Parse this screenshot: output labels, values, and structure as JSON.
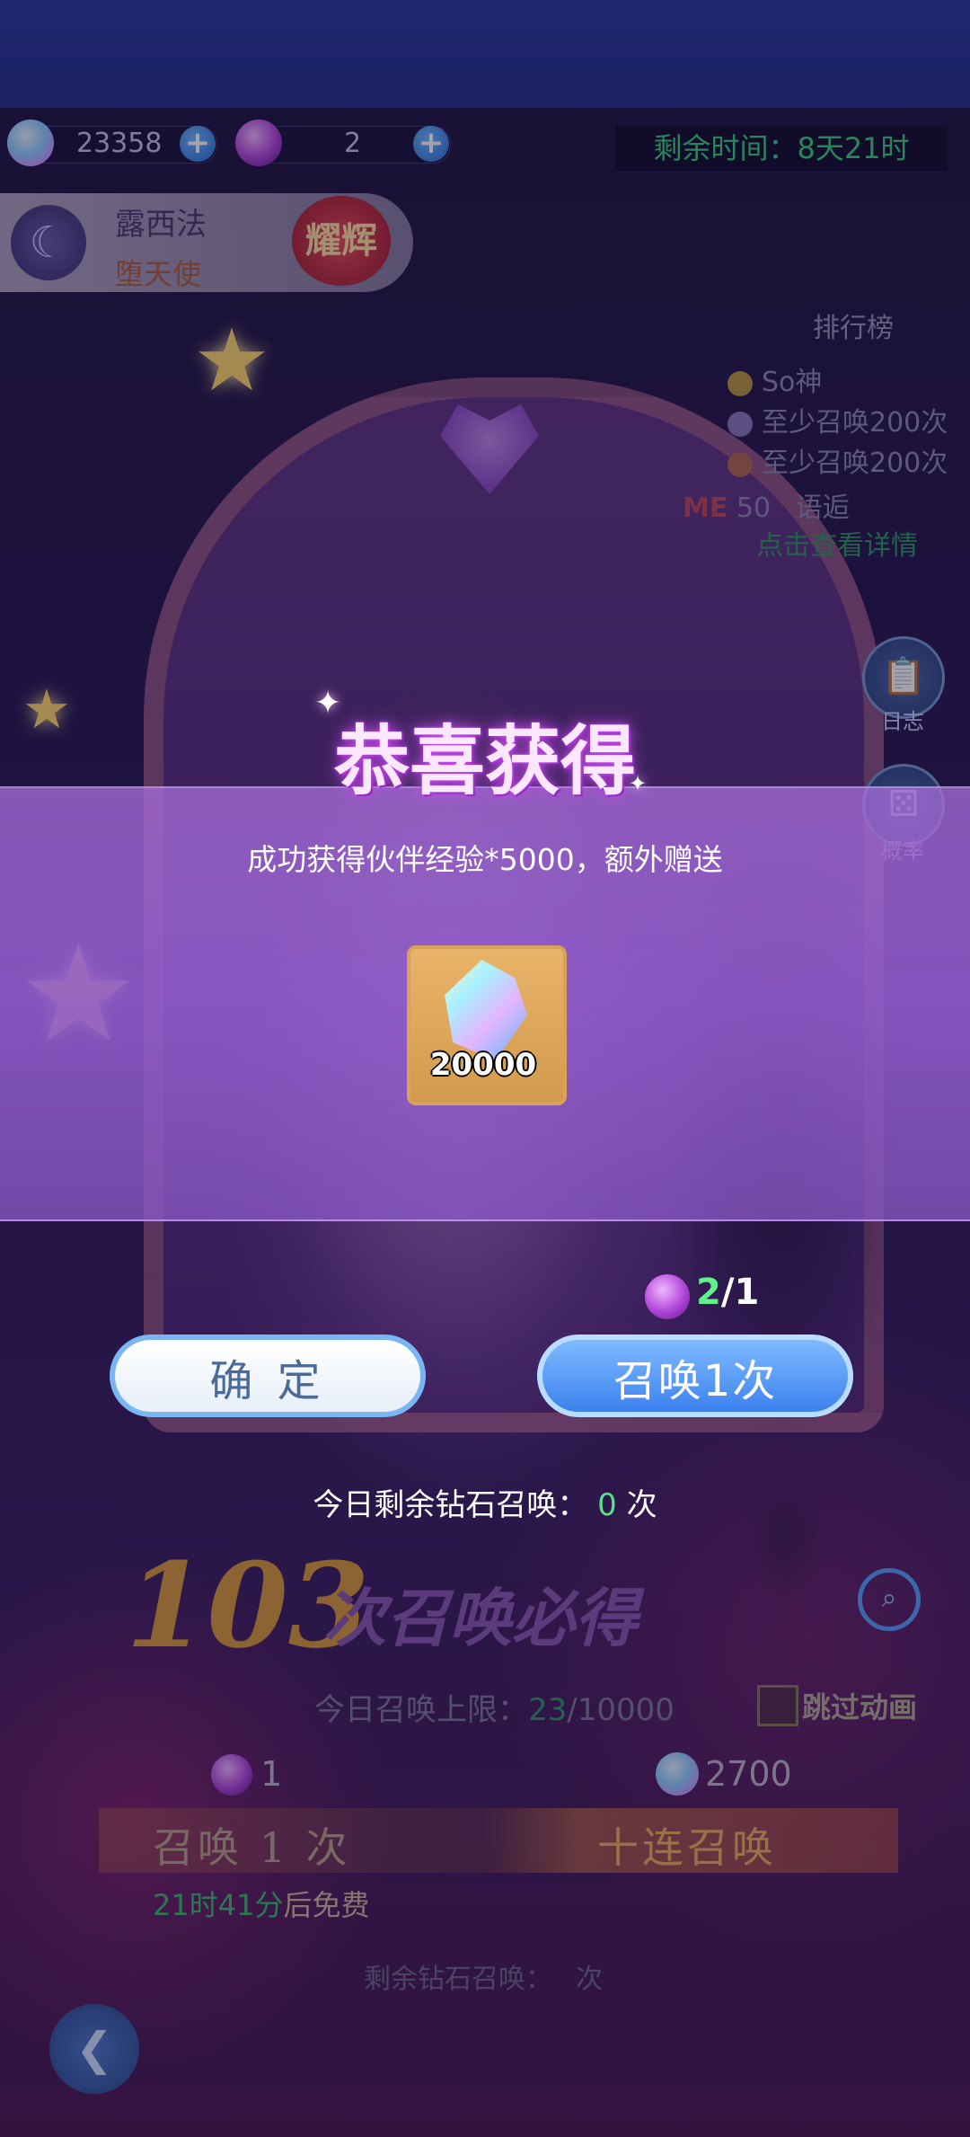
{
  "resources": {
    "diamonds": "23358",
    "feathers": "2",
    "plus_label": "+"
  },
  "timer": "剩余时间：8天21时",
  "hero": {
    "name": "露西法",
    "title": "堕天使",
    "rank_badge": "耀辉"
  },
  "ranking": {
    "title": "排行榜",
    "entries": [
      {
        "rank": "1",
        "name": "So神"
      },
      {
        "rank": "2",
        "name": "至少召唤200次"
      },
      {
        "rank": "3",
        "name": "至少召唤200次"
      }
    ],
    "me_label": "ME",
    "me_rank": "50",
    "me_name": "语逅",
    "details_link": "点击查看详情"
  },
  "side_buttons": {
    "log_label": "日志",
    "log_icon": "📋",
    "prob_label": "概率",
    "prob_icon": "⚄"
  },
  "popup": {
    "title": "恭喜获得",
    "message": "成功获得伙伴经验*5000，额外赠送",
    "item": {
      "icon": "diamond-gem",
      "count": "20000"
    },
    "summon_cost": {
      "have": "2",
      "need": "/1"
    },
    "confirm_label": "确 定",
    "summon_label": "召唤1次",
    "diamond_today_prefix": "今日剩余钻石召唤：",
    "diamond_today_count": "0",
    "diamond_today_suffix": "次"
  },
  "background_ui": {
    "guarantee_num": "103",
    "guarantee_text": "次召唤必得",
    "daily_limit_prefix": "今日召唤上限：",
    "daily_limit_used": "23",
    "daily_limit_total": "/10000",
    "skip_animation": "跳过动画",
    "single_cost": "1",
    "ten_cost": "2700",
    "summon_one": "召唤 1 次",
    "summon_ten": "十连召唤",
    "free_time": "21时41分",
    "free_suffix": "后免费",
    "remain_diamond_prefix": "剩余钻石召唤：",
    "remain_diamond_suffix": "次"
  },
  "colors": {
    "accent_green": "#3dd17a",
    "popup_purple": "#9a5fd2",
    "button_blue": "#3c82ee"
  }
}
